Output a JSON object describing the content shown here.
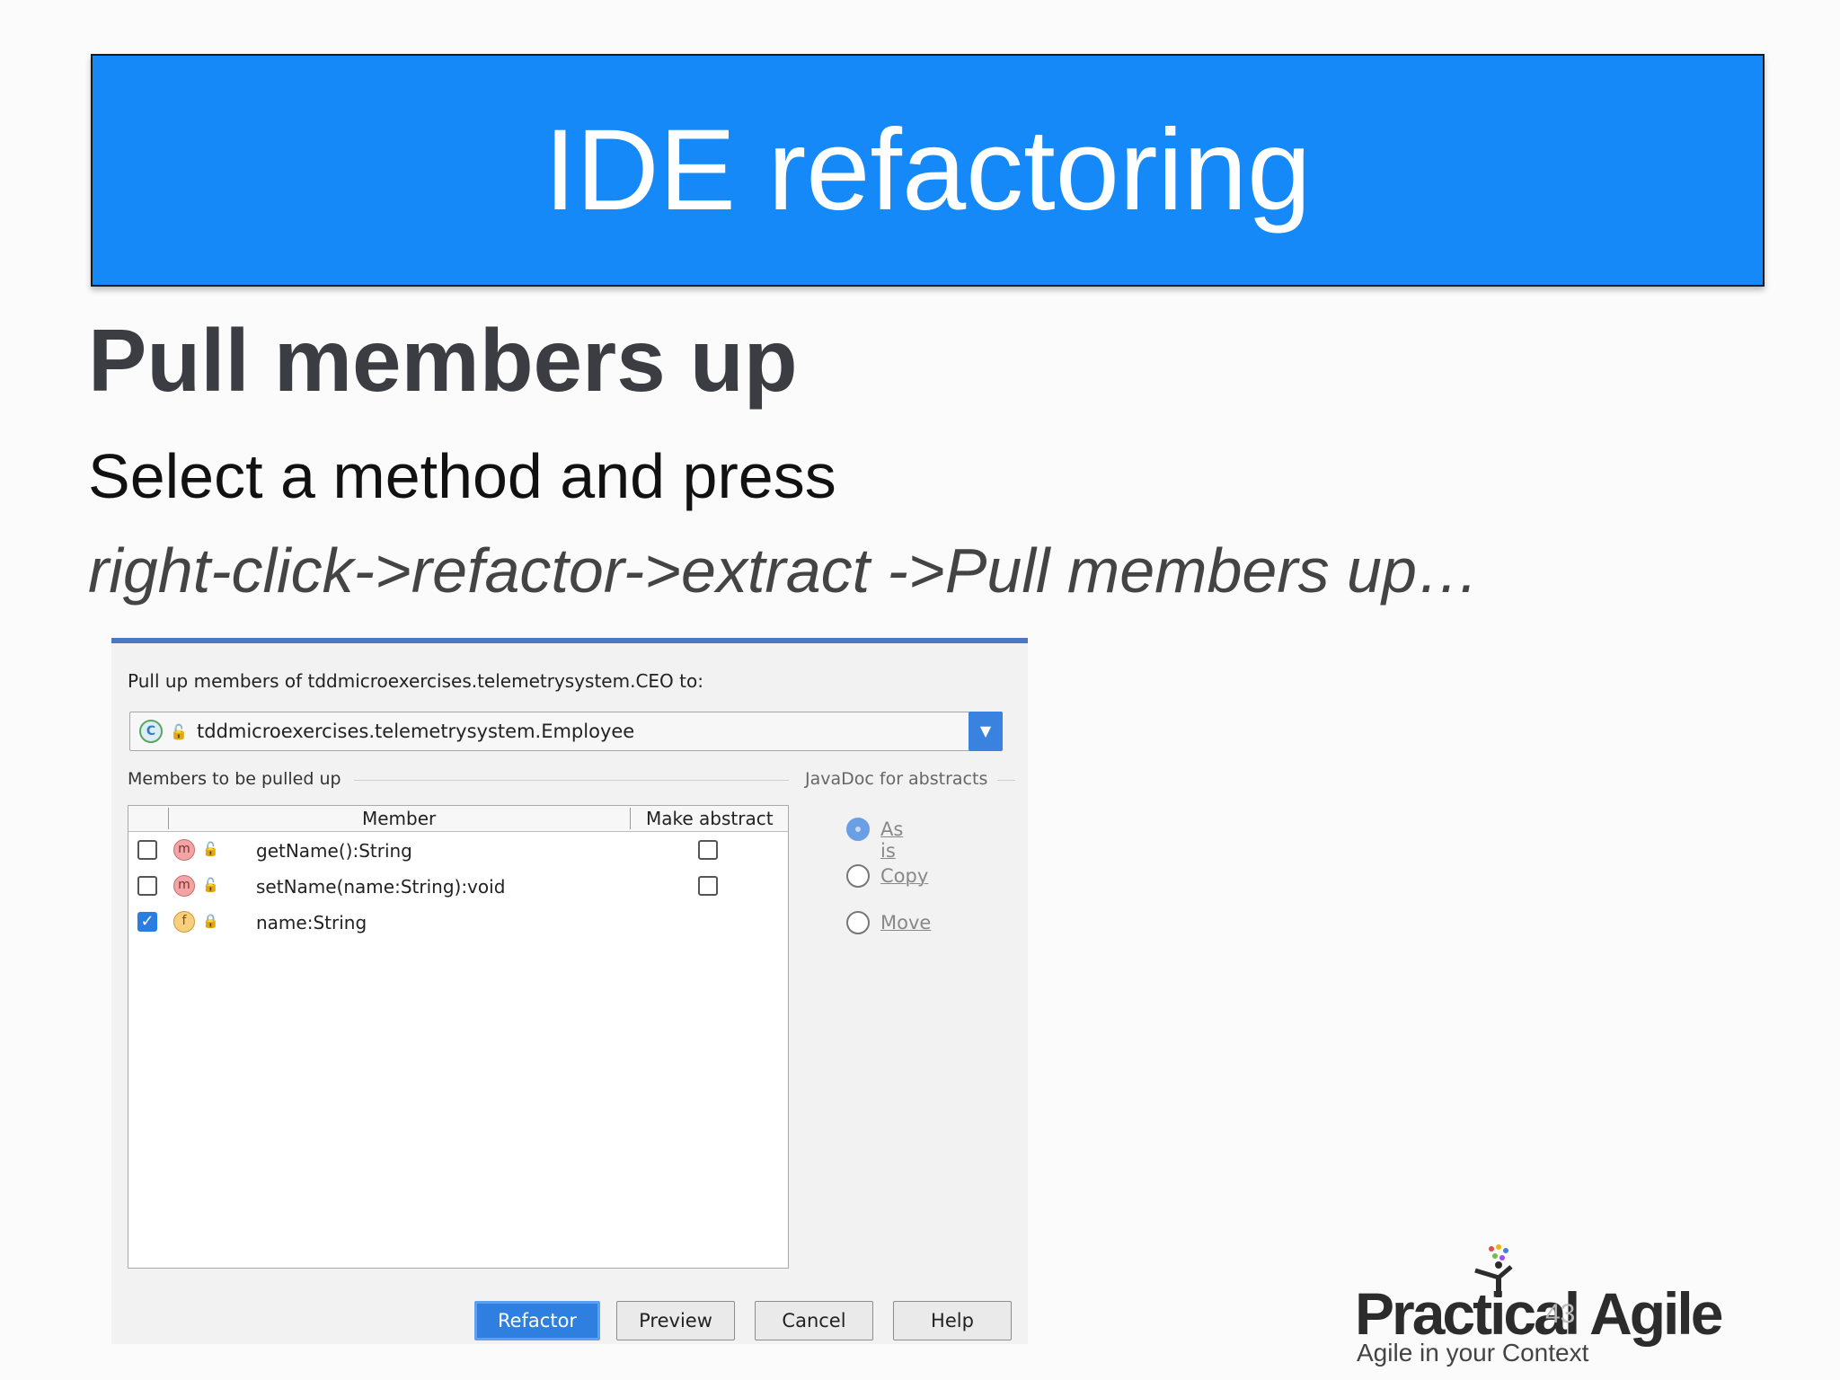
{
  "slide": {
    "banner_title": "IDE refactoring",
    "heading": "Pull members up",
    "line1": "Select a method and press",
    "line2": "right-click->refactor->extract ->Pull members up…",
    "page_number": "43"
  },
  "dialog": {
    "target_label": "Pull up members of tddmicroexercises.telemetrysystem.CEO to:",
    "target_value": "tddmicroexercises.telemetrysystem.Employee",
    "members_section": "Members to be pulled up",
    "javadoc_section": "JavaDoc for abstracts",
    "columns": [
      "Member",
      "Make abstract"
    ],
    "members": [
      {
        "name": "getName():String",
        "kind": "m",
        "checked": false,
        "abstract_checkbox": true
      },
      {
        "name": "setName(name:String):void",
        "kind": "m",
        "checked": false,
        "abstract_checkbox": true
      },
      {
        "name": "name:String",
        "kind": "f",
        "checked": true,
        "abstract_checkbox": false
      }
    ],
    "javadoc_options": [
      {
        "label": "As is",
        "selected": true
      },
      {
        "label": "Copy",
        "selected": false
      },
      {
        "label": "Move",
        "selected": false
      }
    ],
    "buttons": {
      "refactor": "Refactor",
      "preview": "Preview",
      "cancel": "Cancel",
      "help": "Help"
    }
  },
  "logo": {
    "name": "Practical Agile",
    "tagline": "Agile in your Context"
  },
  "colors": {
    "banner": "#1589f8",
    "accent": "#2f7fe0"
  }
}
